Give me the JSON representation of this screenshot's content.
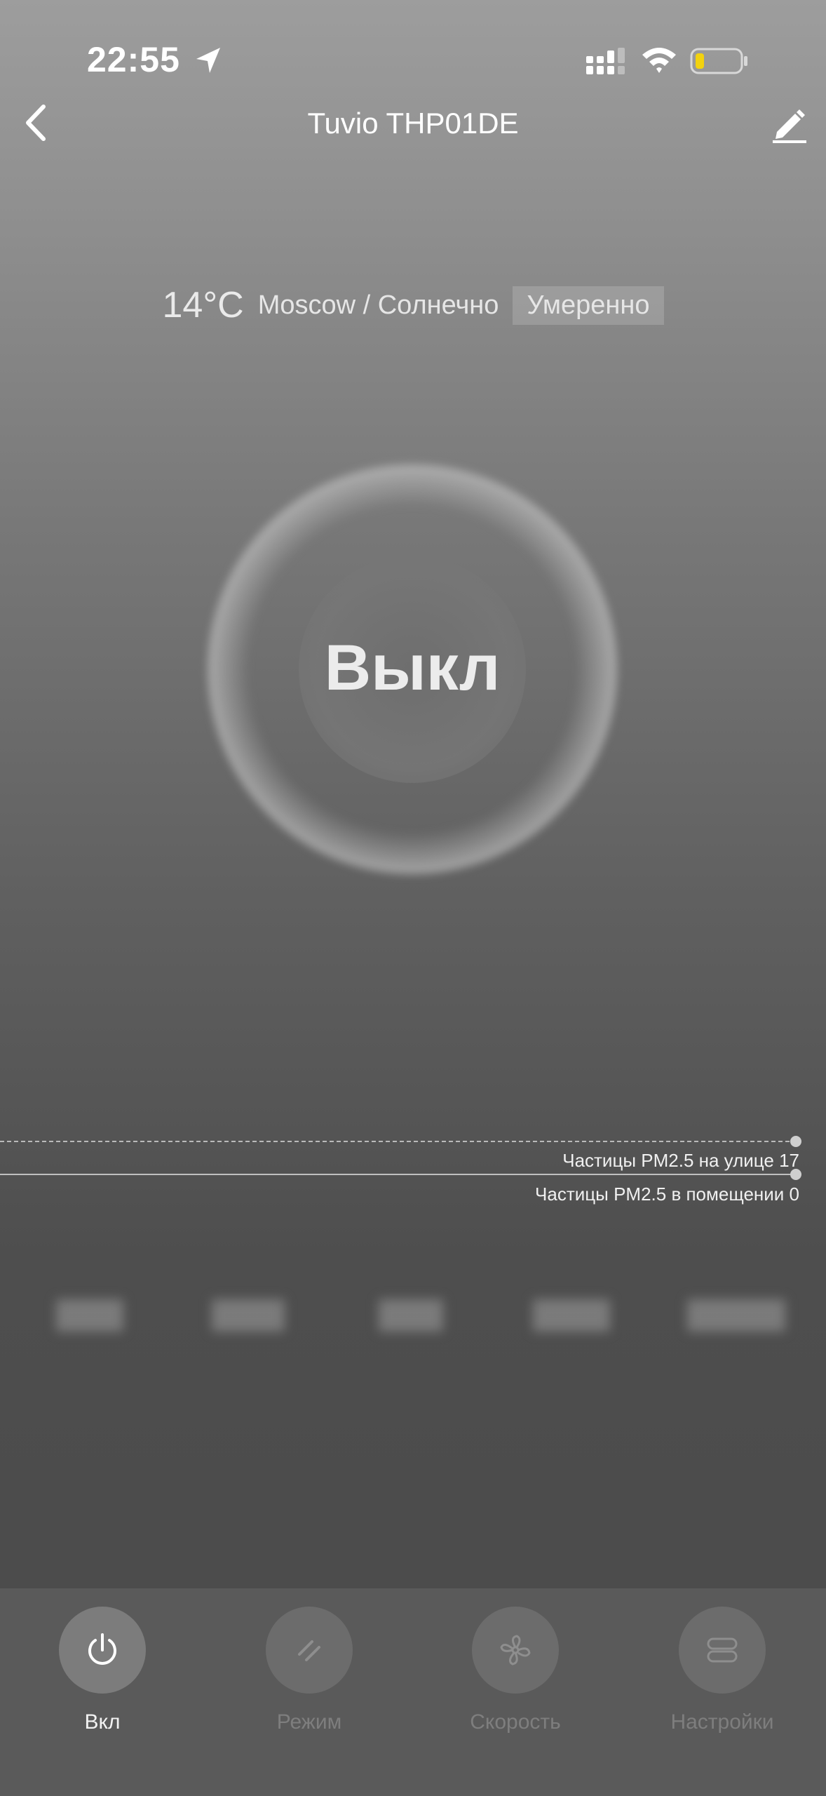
{
  "status_bar": {
    "time": "22:55",
    "icons": [
      "location-arrow-icon",
      "cellular-signal-icon",
      "wifi-icon",
      "battery-low-icon"
    ]
  },
  "nav": {
    "back_icon": "chevron-left-icon",
    "title": "Tuvio THP01DE",
    "edit_icon": "pencil-icon"
  },
  "weather": {
    "temperature": "14°C",
    "location_condition": "Moscow / Солнечно",
    "air_quality": "Умеренно"
  },
  "power_ring": {
    "state_label": "Выкл"
  },
  "pm25": {
    "outdoor_label": "Частицы PM2.5 на улице 17",
    "indoor_label": "Частицы PM2.5 в помещении 0"
  },
  "tabs": [
    {
      "label": "Вкл",
      "icon": "power-icon",
      "active": true
    },
    {
      "label": "Режим",
      "icon": "mode-slashes-icon",
      "active": false
    },
    {
      "label": "Скорость",
      "icon": "fan-icon",
      "active": false
    },
    {
      "label": "Настройки",
      "icon": "settings-toggles-icon",
      "active": false
    }
  ],
  "colors": {
    "background_top": "#9d9d9d",
    "background_bottom": "#4a4a4a",
    "tab_bar": "#5a5a5a",
    "active_text": "#f2f2f2",
    "inactive_text": "#7e7e7e"
  }
}
